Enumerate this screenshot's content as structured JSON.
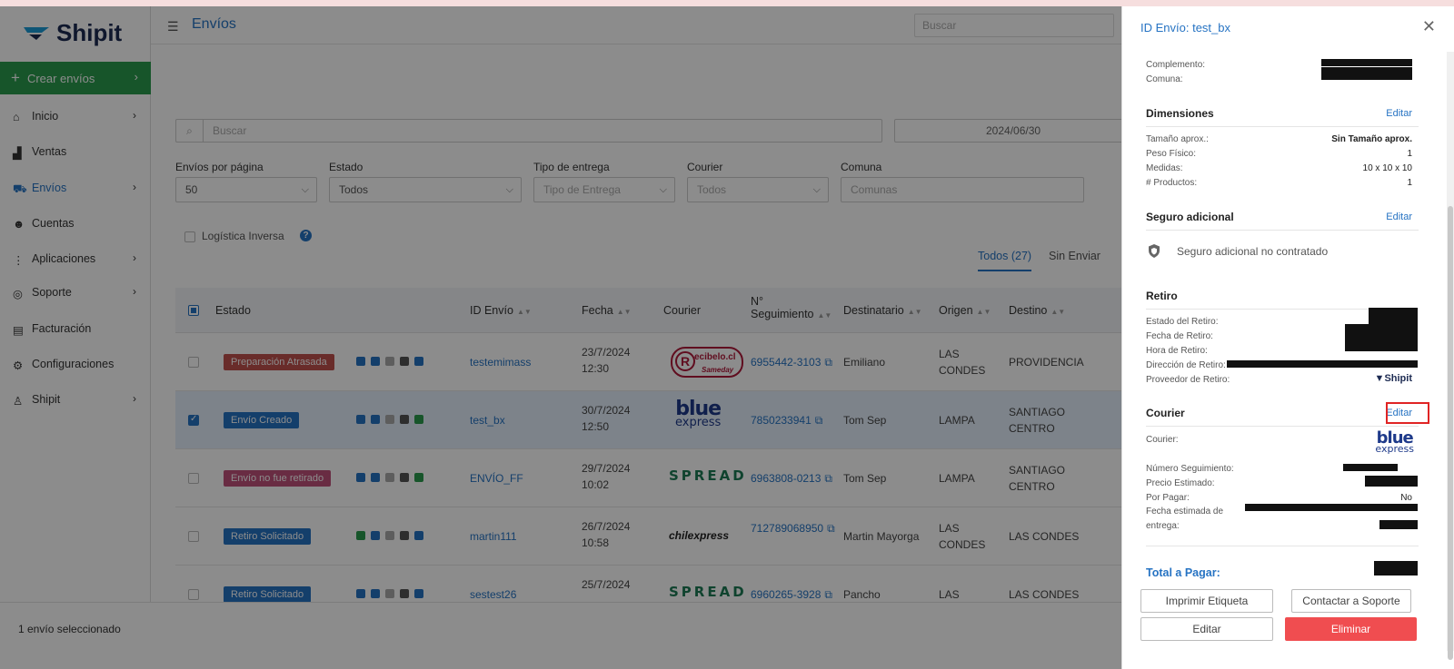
{
  "app": {
    "brand": "Shipit",
    "page_title": "Envíos",
    "search_placeholder": "Buscar"
  },
  "sidebar": {
    "create_label": "Crear envíos",
    "items": [
      {
        "label": "Inicio",
        "icon": "home-icon",
        "chevron": true
      },
      {
        "label": "Ventas",
        "icon": "chart-icon",
        "chevron": false
      },
      {
        "label": "Envíos",
        "icon": "truck-icon",
        "chevron": true,
        "active": true
      },
      {
        "label": "Cuentas",
        "icon": "users-icon",
        "chevron": false
      },
      {
        "label": "Aplicaciones",
        "icon": "grid-icon",
        "chevron": true
      },
      {
        "label": "Soporte",
        "icon": "lifebuoy-icon",
        "chevron": true
      },
      {
        "label": "Facturación",
        "icon": "invoice-icon",
        "chevron": false
      },
      {
        "label": "Configuraciones",
        "icon": "gear-icon",
        "chevron": false
      },
      {
        "label": "Shipit",
        "icon": "user-icon",
        "chevron": true
      }
    ]
  },
  "filters": {
    "search_placeholder": "Buscar",
    "date": "2024/06/30",
    "per_page_label": "Envíos por página",
    "per_page_value": "50",
    "estado_label": "Estado",
    "estado_value": "Todos",
    "tipo_label": "Tipo de entrega",
    "tipo_placeholder": "Tipo de Entrega",
    "courier_label": "Courier",
    "courier_value": "Todos",
    "comuna_label": "Comuna",
    "comuna_placeholder": "Comunas",
    "logistica_label": "Logística Inversa",
    "help": "?"
  },
  "tabs": {
    "todos": "Todos (27)",
    "sin_enviar": "Sin Enviar"
  },
  "table": {
    "headers": {
      "estado": "Estado",
      "id": "ID Envío",
      "fecha": "Fecha",
      "courier": "Courier",
      "seguimiento": "N° Seguimiento",
      "destinatario": "Destinatario",
      "origen": "Origen",
      "destino": "Destino"
    },
    "rows": [
      {
        "status": "Preparación Atrasada",
        "status_color": "#c0504d",
        "id": "testemimass",
        "fecha1": "23/7/2024",
        "fecha2": "12:30",
        "courier": "recibelo",
        "seguimiento": "6955442-3103",
        "destinatario": "Emiliano",
        "origen1": "LAS",
        "origen2": "CONDES",
        "destino1": "PROVIDENCIA",
        "destino2": "",
        "checked": false
      },
      {
        "status": "Envío Creado",
        "status_color": "#2673c3",
        "id": "test_bx",
        "fecha1": "30/7/2024",
        "fecha2": "12:50",
        "courier": "blue",
        "seguimiento": "7850233941",
        "destinatario": "Tom Sep",
        "origen1": "LAMPA",
        "origen2": "",
        "destino1": "SANTIAGO",
        "destino2": "CENTRO",
        "checked": true
      },
      {
        "status": "Envío no fue retirado",
        "status_color": "#c0507a",
        "id": "ENVÍO_FF",
        "fecha1": "29/7/2024",
        "fecha2": "10:02",
        "courier": "spread",
        "seguimiento": "6963808-0213",
        "destinatario": "Tom Sep",
        "origen1": "LAMPA",
        "origen2": "",
        "destino1": "SANTIAGO",
        "destino2": "CENTRO",
        "checked": false
      },
      {
        "status": "Retiro Solicitado",
        "status_color": "#2673c3",
        "id": "martin111",
        "fecha1": "26/7/2024",
        "fecha2": "10:58",
        "courier": "chilexpress",
        "seguimiento": "712789068950",
        "destinatario": "Martin Mayorga",
        "origen1": "LAS",
        "origen2": "CONDES",
        "destino1": "LAS CONDES",
        "destino2": "",
        "checked": false
      },
      {
        "status": "Retiro Solicitado",
        "status_color": "#2673c3",
        "id": "sestest26",
        "fecha1": "25/7/2024",
        "fecha2": "",
        "courier": "spread",
        "seguimiento": "6960265-3928",
        "destinatario": "Pancho",
        "origen1": "LAS",
        "origen2": "",
        "destino1": "LAS CONDES",
        "destino2": "",
        "checked": false
      }
    ],
    "courier_text": {
      "recibelo_r": "R",
      "recibelo": "ecibelo.cl",
      "recibelo_sub": "Sameday",
      "blue1": "blue",
      "blue2": "express",
      "spread": "SPREAD",
      "chilexpress": "chilexpress"
    }
  },
  "footer": {
    "selected": "1 envío seleccionado"
  },
  "drawer": {
    "title": "ID Envío: test_bx",
    "address": {
      "complemento": "Complemento:",
      "comuna": "Comuna:"
    },
    "dimensiones": {
      "title": "Dimensiones",
      "edit": "Editar",
      "tamano_k": "Tamaño aprox.:",
      "tamano_v": "Sin Tamaño aprox.",
      "peso_k": "Peso Físico:",
      "peso_v": "1",
      "medidas_k": "Medidas:",
      "medidas_v": "10 x 10 x 10",
      "productos_k": "# Productos:",
      "productos_v": "1"
    },
    "seguro": {
      "title": "Seguro adicional",
      "edit": "Editar",
      "text": "Seguro adicional no contratado"
    },
    "retiro": {
      "title": "Retiro",
      "estado": "Estado del Retiro:",
      "fecha": "Fecha de Retiro:",
      "hora": "Hora de Retiro:",
      "direccion": "Dirección de Retiro:",
      "proveedor": "Proveedor de Retiro:",
      "proveedor_v": "Shipit"
    },
    "courier": {
      "title": "Courier",
      "edit": "Editar",
      "courier_k": "Courier:",
      "blue1": "blue",
      "blue2": "express",
      "numero": "Número Seguimiento:",
      "precio": "Precio Estimado:",
      "por_pagar_k": "Por Pagar:",
      "por_pagar_v": "No",
      "fecha1": "Fecha estimada de",
      "fecha2": "entrega:"
    },
    "total": "Total a Pagar:",
    "buttons": {
      "imprimir": "Imprimir Etiqueta",
      "contactar": "Contactar a Soporte",
      "editar": "Editar",
      "eliminar": "Eliminar"
    }
  }
}
